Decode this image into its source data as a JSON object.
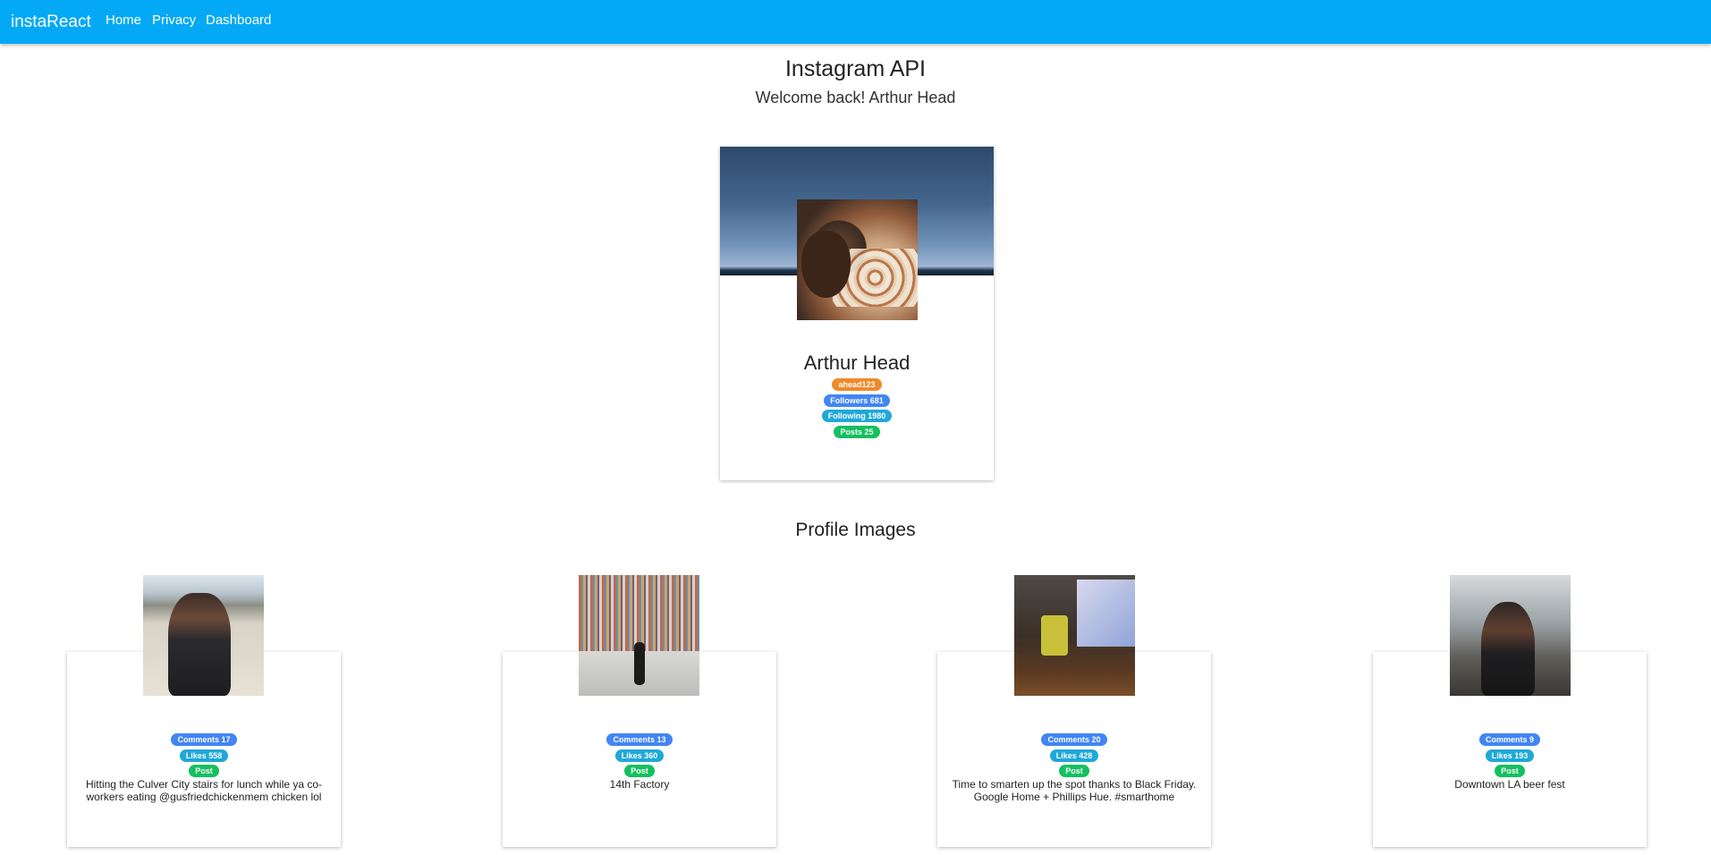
{
  "nav": {
    "brand": "instaReact",
    "links": [
      "Home",
      "Privacy",
      "Dashboard"
    ]
  },
  "header": {
    "title": "Instagram API",
    "subtitle": "Welcome back! Arthur Head"
  },
  "profile": {
    "name": "Arthur Head",
    "username": "ahead123",
    "followers": "Followers 681",
    "following": "Following 1980",
    "posts": "Posts 25"
  },
  "section": {
    "title": "Profile Images"
  },
  "posts": [
    {
      "comments": "Comments 17",
      "likes": "Likes 558",
      "type": "Post",
      "caption": "Hitting the Culver City stairs for lunch while ya co-workers eating @gusfriedchickenmem chicken lol"
    },
    {
      "comments": "Comments 13",
      "likes": "Likes 360",
      "type": "Post",
      "caption": "14th Factory"
    },
    {
      "comments": "Comments 20",
      "likes": "Likes 428",
      "type": "Post",
      "caption": "Time to smarten up the spot thanks to Black Friday. Google Home + Phillips Hue. #smarthome"
    },
    {
      "comments": "Comments 9",
      "likes": "Likes 193",
      "type": "Post",
      "caption": "Downtown LA beer fest"
    }
  ],
  "colors": {
    "navbar": "#03a9f4",
    "badge_orange": "#ef8a2a",
    "badge_blue": "#4285f4",
    "badge_cyan": "#20a8d8",
    "badge_green": "#13c060"
  }
}
